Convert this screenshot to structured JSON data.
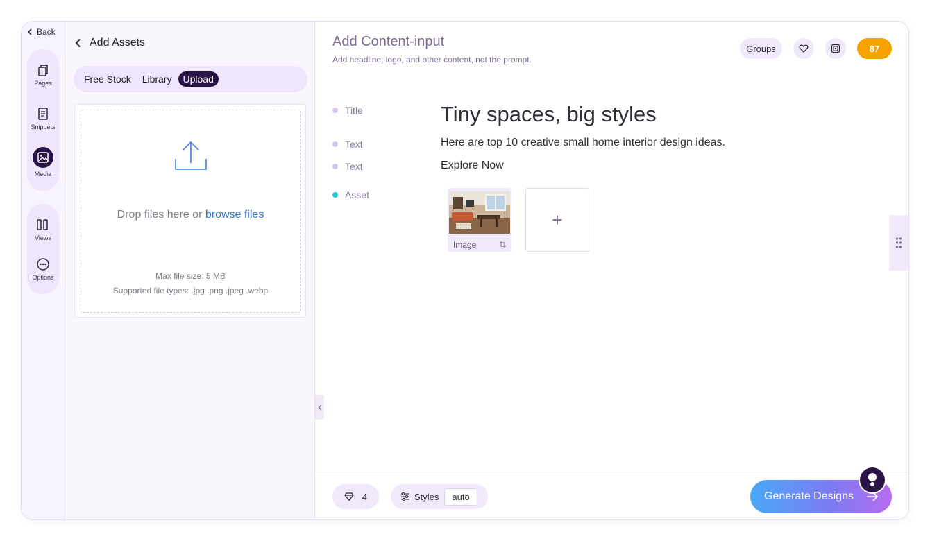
{
  "rail": {
    "back_label": "Back",
    "items": [
      {
        "label": "Pages",
        "icon": "pages-icon"
      },
      {
        "label": "Snippets",
        "icon": "snippets-icon"
      },
      {
        "label": "Media",
        "icon": "media-icon",
        "active": true
      },
      {
        "label": "Views",
        "icon": "views-icon"
      },
      {
        "label": "Options",
        "icon": "options-icon"
      }
    ]
  },
  "assets_panel": {
    "title": "Add Assets",
    "tabs": [
      "Free Stock",
      "Library",
      "Upload"
    ],
    "active_tab": "Upload",
    "dropzone": {
      "text": "Drop files here or",
      "link": "browse files",
      "max_size": "Max file size: 5 MB",
      "file_types": "Supported file types: .jpg .png .jpeg .webp"
    }
  },
  "main": {
    "title": "Add Content-input",
    "subtitle": "Add headline, logo, and other content, not the prompt.",
    "groups_label": "Groups",
    "credits": "87",
    "fields": [
      {
        "label": "Title",
        "value": "Tiny spaces, big styles"
      },
      {
        "label": "Text",
        "value": "Here are top 10 creative small home interior design ideas."
      },
      {
        "label": "Text",
        "value": "Explore Now"
      },
      {
        "label": "Asset"
      }
    ],
    "asset_caption": "Image",
    "add_symbol": "+"
  },
  "bottom": {
    "gems": "4",
    "styles_label": "Styles",
    "styles_value": "auto",
    "generate_label": "Generate Designs"
  },
  "colors": {
    "accent_dark": "#2a1346",
    "credits_bg": "#f5a300",
    "link": "#2b71d6",
    "asset_dot": "#22c7d9"
  }
}
